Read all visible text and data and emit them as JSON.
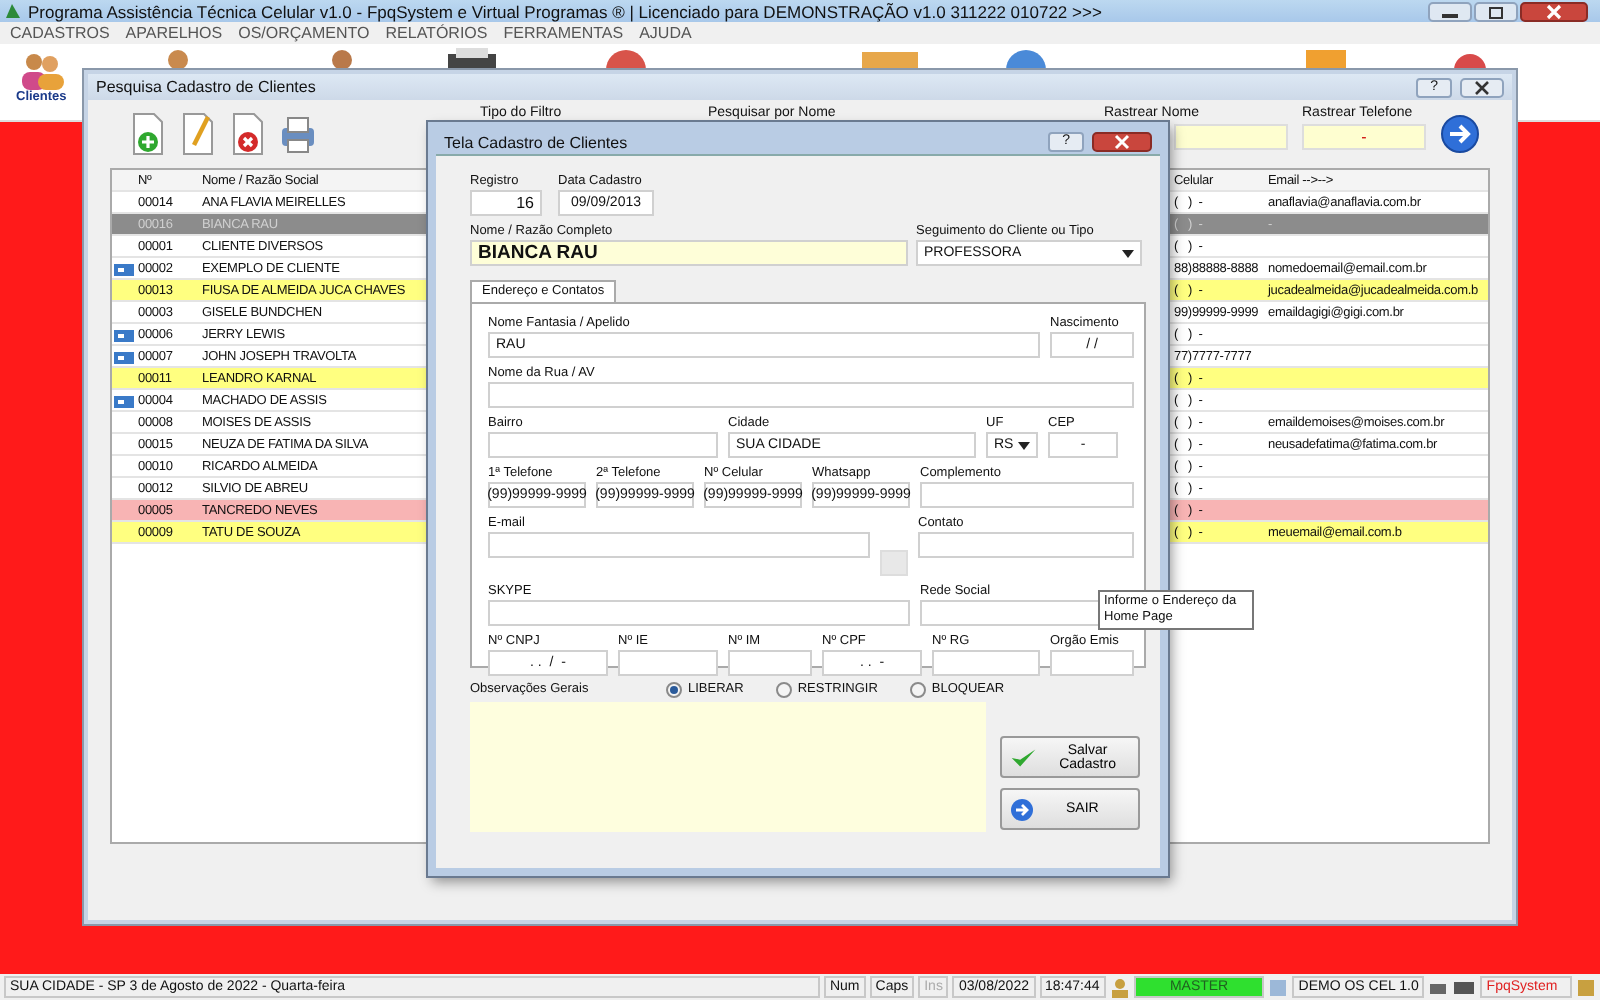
{
  "app_title": "Programa Assistência Técnica Celular v1.0 - FpqSystem e Virtual Programas ® | Licenciado para  DEMONSTRAÇÃO v1.0 311222 010722 >>>",
  "menu": [
    "CADASTROS",
    "APARELHOS",
    "OS/ORÇAMENTO",
    "RELATÓRIOS",
    "FERRAMENTAS",
    "AJUDA"
  ],
  "toolbar_label": "Clientes",
  "search_window": {
    "title": "Pesquisa Cadastro de Clientes",
    "help": "?",
    "filters": [
      {
        "label": "Tipo do Filtro"
      },
      {
        "label": "Pesquisar por Nome"
      },
      {
        "label": "Rastrear Nome"
      },
      {
        "label": "Rastrear Telefone",
        "value": "-"
      }
    ],
    "columns": [
      "Nº",
      "Nome / Razão Social",
      "Celular",
      "Email -->-->"
    ],
    "rows": [
      {
        "num": "00014",
        "name": "ANA FLAVIA MEIRELLES",
        "cel": "(   )  -",
        "email": "anaflavia@anaflavia.com.br",
        "flagged": false,
        "selected": false,
        "color": "#ffffff"
      },
      {
        "num": "00016",
        "name": "BIANCA RAU",
        "cel": "(   )  -",
        "email": "-",
        "flagged": false,
        "selected": true,
        "color": "#8c8c8c"
      },
      {
        "num": "00001",
        "name": "CLIENTE DIVERSOS",
        "cel": "(   )  -",
        "flagged": false,
        "selected": false,
        "color": "#ffffff"
      },
      {
        "num": "00002",
        "name": "EXEMPLO DE CLIENTE",
        "cel": "88)88888-8888",
        "email": "nomedoemail@email.com.br",
        "flagged": true,
        "selected": false,
        "color": "#ffffff"
      },
      {
        "num": "00013",
        "name": "FIUSA DE ALMEIDA JUCA CHAVES",
        "cel": "(   )  -",
        "email": "jucadealmeida@jucadealmeida.com.b",
        "flagged": false,
        "selected": false,
        "color": "#ffff80"
      },
      {
        "num": "00003",
        "name": "GISELE BUNDCHEN",
        "cel": "99)99999-9999",
        "email": "emaildagigi@gigi.com.br",
        "flagged": false,
        "selected": false,
        "color": "#ffffff"
      },
      {
        "num": "00006",
        "name": "JERRY LEWIS",
        "cel": "(   )  -",
        "flagged": true,
        "selected": false,
        "color": "#ffffff"
      },
      {
        "num": "00007",
        "name": "JOHN JOSEPH TRAVOLTA",
        "cel": "77)7777-7777",
        "flagged": true,
        "selected": false,
        "color": "#ffffff"
      },
      {
        "num": "00011",
        "name": "LEANDRO KARNAL",
        "cel": "(   )  -",
        "flagged": false,
        "selected": false,
        "color": "#ffff80"
      },
      {
        "num": "00004",
        "name": "MACHADO DE ASSIS",
        "cel": "(   )  -",
        "flagged": true,
        "selected": false,
        "color": "#ffffff"
      },
      {
        "num": "00008",
        "name": "MOISES DE ASSIS",
        "cel": "(   )  -",
        "email": "emaildemoises@moises.com.br",
        "flagged": false,
        "selected": false,
        "color": "#ffffff"
      },
      {
        "num": "00015",
        "name": "NEUZA DE FATIMA DA SILVA",
        "cel": "(   )  -",
        "email": "neusadefatima@fatima.com.br",
        "flagged": false,
        "selected": false,
        "color": "#ffffff"
      },
      {
        "num": "00010",
        "name": "RICARDO ALMEIDA",
        "cel": "(   )  -",
        "flagged": false,
        "selected": false,
        "color": "#ffffff"
      },
      {
        "num": "00012",
        "name": "SILVIO DE ABREU",
        "cel": "(   )  -",
        "flagged": false,
        "selected": false,
        "color": "#ffffff"
      },
      {
        "num": "00005",
        "name": "TANCREDO NEVES",
        "cel": "(   )  -",
        "flagged": false,
        "selected": false,
        "color": "#f8b4b4"
      },
      {
        "num": "00009",
        "name": "TATU DE SOUZA",
        "cel": "(   )  -",
        "email": "meuemail@email.com.b",
        "flagged": false,
        "selected": false,
        "color": "#ffff80"
      }
    ]
  },
  "dialog": {
    "title": "Tela Cadastro de Clientes",
    "help": "?",
    "registro": {
      "label": "Registro",
      "value": "16"
    },
    "data_cadastro": {
      "label": "Data Cadastro",
      "value": "09/09/2013"
    },
    "nome": {
      "label": "Nome / Razão Completo",
      "value": "BIANCA RAU"
    },
    "segmento": {
      "label": "Seguimento do Cliente ou Tipo",
      "value": "PROFESSORA"
    },
    "tab": {
      "label": "Endereço e Contatos",
      "selected": true
    },
    "form_rows": [
      [
        {
          "kind": "text",
          "label": "Nome Fantasia / Apelido",
          "value": "RAU"
        },
        {
          "kind": "masked",
          "label": "Nascimento",
          "value": "/ /"
        }
      ],
      [
        {
          "kind": "text",
          "label": "Nome da Rua / AV"
        }
      ],
      [
        {
          "kind": "text",
          "label": "Bairro"
        },
        {
          "kind": "text",
          "label": "Cidade",
          "value": "SUA CIDADE"
        },
        {
          "kind": "select",
          "label": "UF",
          "value": "RS"
        },
        {
          "kind": "masked",
          "label": "CEP",
          "value": "-"
        }
      ],
      [
        {
          "kind": "masked",
          "label": "1ª Telefone",
          "value": "(99)99999-9999"
        },
        {
          "kind": "masked",
          "label": "2ª Telefone",
          "value": "(99)99999-9999"
        },
        {
          "kind": "masked",
          "label": "Nº Celular",
          "value": "(99)99999-9999"
        },
        {
          "kind": "masked",
          "label": "Whatsapp",
          "value": "(99)99999-9999"
        },
        {
          "kind": "text",
          "label": "Complemento"
        }
      ],
      [
        {
          "kind": "text",
          "label": "E-mail"
        },
        {
          "kind": "swatch"
        },
        {
          "kind": "text",
          "label": "Contato"
        }
      ],
      [
        {
          "kind": "text",
          "label": "SKYPE"
        },
        {
          "kind": "text",
          "label": "Rede Social"
        }
      ],
      [
        {
          "kind": "masked",
          "label": "Nº CNPJ",
          "value": ". .  /  -"
        },
        {
          "kind": "text",
          "label": "Nº IE"
        },
        {
          "kind": "text",
          "label": "Nº IM"
        },
        {
          "kind": "masked",
          "label": "Nº CPF",
          "value": ". .  -"
        },
        {
          "kind": "text",
          "label": "Nº RG"
        },
        {
          "kind": "text",
          "label": "Orgão Emis"
        }
      ]
    ],
    "tooltip": "Informe o Endereço da Home Page",
    "obs_label": "Observações Gerais",
    "status_options": [
      {
        "label": "LIBERAR",
        "selected": true
      },
      {
        "label": "RESTRINGIR",
        "selected": false
      },
      {
        "label": "BLOQUEAR",
        "selected": false
      }
    ],
    "save_button": "Salvar Cadastro",
    "exit_button": "SAIR"
  },
  "status_bar": {
    "location": "SUA CIDADE - SP  3 de Agosto de 2022 - Quarta-feira",
    "keys": [
      {
        "label": "Num",
        "disabled": false
      },
      {
        "label": "Caps",
        "disabled": false
      },
      {
        "label": "Ins",
        "disabled": true
      }
    ],
    "date": "03/08/2022",
    "time": "18:47:44",
    "user": "MASTER",
    "version": "DEMO OS CEL 1.0",
    "brand": "FpqSystem"
  }
}
